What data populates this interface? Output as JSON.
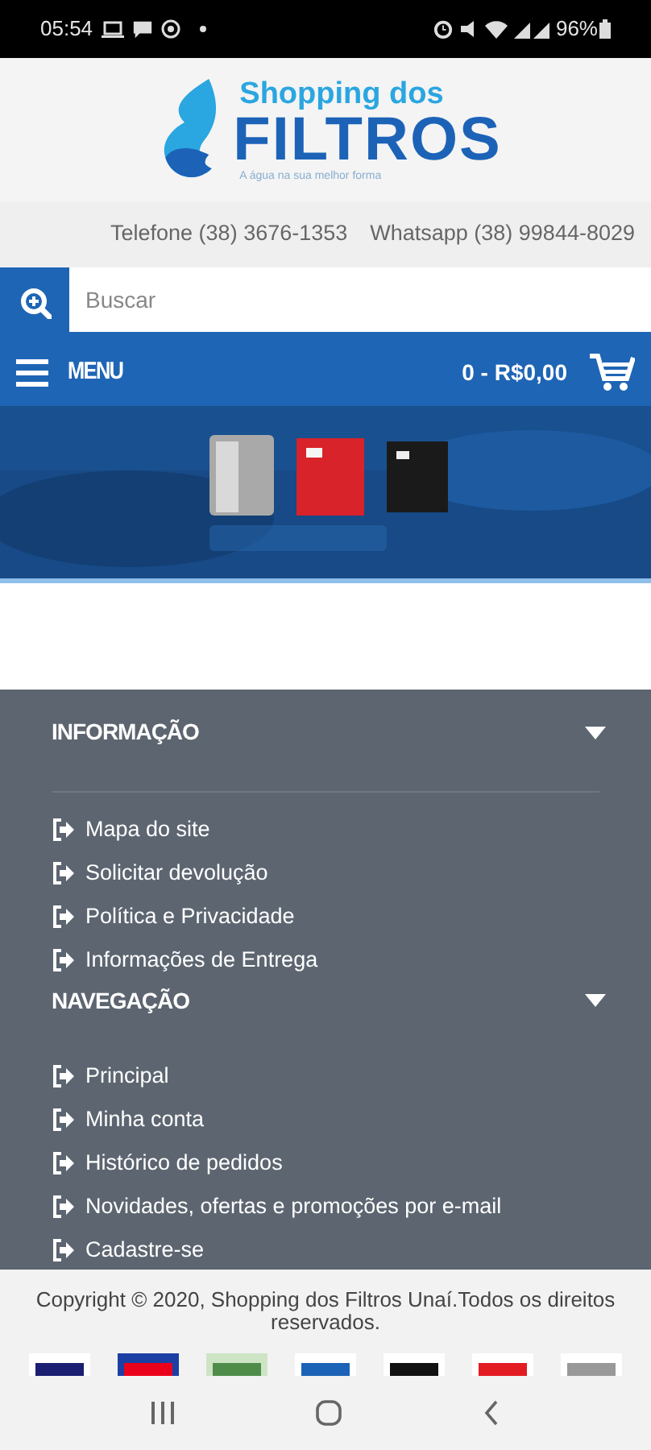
{
  "status_bar": {
    "time": "05:54",
    "battery": "96%"
  },
  "logo": {
    "line_1": "Shopping dos",
    "line_2": "FILTROS",
    "tagline": "A água na sua melhor forma"
  },
  "contacts": [
    "Telefone (38) 3676-1353",
    "Whatsapp (38) 99844-8029"
  ],
  "search": {
    "placeholder": "Buscar"
  },
  "menu_bar": {
    "label": "MENU",
    "cart": "0 - R$0,00"
  },
  "footer_sections": [
    {
      "title": "INFORMAÇÃO",
      "links": [
        "Mapa do site",
        "Solicitar devolução",
        "Política e Privacidade",
        "Informações de Entrega"
      ]
    },
    {
      "title": "NAVEGAÇÃO",
      "links": [
        "Principal",
        "Minha conta",
        "Histórico de pedidos",
        "Novidades, ofertas e promoções por e-mail",
        "Cadastre-se"
      ]
    }
  ],
  "copyright": "Copyright © 2020, Shopping dos Filtros Unaí.Todos os direitos reservados."
}
